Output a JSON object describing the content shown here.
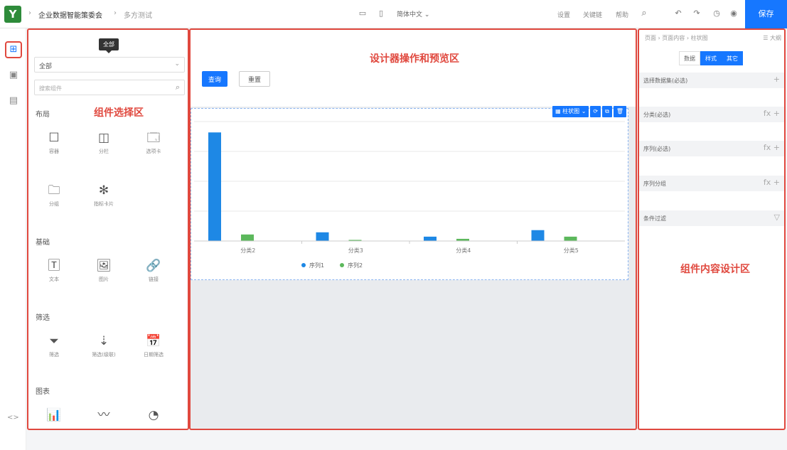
{
  "header": {
    "logo_text": "Y",
    "breadcrumb": [
      "企业数据智能策委会",
      "多方测试"
    ],
    "language": "简体中文",
    "links": [
      "设置",
      "关键链",
      "帮助"
    ],
    "save_label": "保存"
  },
  "rail": {
    "icons": [
      "components-icon",
      "layout-icon",
      "page-icon"
    ],
    "code_toggle": "<>"
  },
  "component_panel": {
    "area_title": "组件选择区",
    "tooltip": "全部",
    "select_value": "全部",
    "search_placeholder": "搜索组件",
    "sections": [
      {
        "label": "布局",
        "items": [
          {
            "label": "容器",
            "icon": "container-icon",
            "glyph": "☐"
          },
          {
            "label": "分栏",
            "icon": "columns-icon",
            "glyph": "◫"
          },
          {
            "label": "选项卡",
            "icon": "tabs-icon",
            "glyph": "🗔"
          },
          {
            "label": "分组",
            "icon": "folder-icon",
            "glyph": "🗀"
          },
          {
            "label": "指标卡片",
            "icon": "metric-card-icon",
            "glyph": "✻"
          }
        ]
      },
      {
        "label": "基础",
        "items": [
          {
            "label": "文本",
            "icon": "text-icon",
            "glyph": "🅃"
          },
          {
            "label": "图片",
            "icon": "image-icon",
            "glyph": "🖼"
          },
          {
            "label": "链接",
            "icon": "link-icon",
            "glyph": "🔗"
          }
        ]
      },
      {
        "label": "筛选",
        "items": [
          {
            "label": "筛选",
            "icon": "filter-icon",
            "glyph": "⏷"
          },
          {
            "label": "筛选(级联)",
            "icon": "cascade-filter-icon",
            "glyph": "⇣"
          },
          {
            "label": "日期筛选",
            "icon": "date-filter-icon",
            "glyph": "📅"
          }
        ]
      },
      {
        "label": "图表",
        "items": [
          {
            "label": "",
            "icon": "bar-chart-icon",
            "glyph": "📊"
          },
          {
            "label": "",
            "icon": "line-chart-icon",
            "glyph": "〰"
          },
          {
            "label": "",
            "icon": "pie-chart-icon",
            "glyph": "◔"
          }
        ]
      }
    ]
  },
  "designer": {
    "area_title": "设计器操作和预览区",
    "query_label": "查询",
    "reset_label": "重置",
    "chart_toolbar": [
      "柱状图",
      "⟳",
      "⧉",
      "🗑"
    ]
  },
  "property_panel": {
    "area_title": "组件内容设计区",
    "breadcrumb": "页面 › 页面内容 › 柱状图",
    "outline_label": "大纲",
    "tabs": [
      "数据",
      "样式",
      "其它"
    ],
    "active_tabs": [
      1,
      2
    ],
    "rows": [
      {
        "label": "选择数据集(必选)",
        "actions": "+"
      },
      {
        "label": "分类(必选)",
        "actions": "fx +"
      },
      {
        "label": "序列(必选)",
        "actions": "fx +"
      },
      {
        "label": "序列分组",
        "actions": "fx +"
      },
      {
        "label": "条件过滤",
        "actions": "▽"
      }
    ]
  },
  "colors": {
    "accent": "#1677ff",
    "annotation": "#e0483e",
    "series1": "#1e88e5",
    "series2": "#5cb85c"
  },
  "chart_data": {
    "type": "bar",
    "categories": [
      "分类2",
      "分类3",
      "分类4",
      "分类5"
    ],
    "series": [
      {
        "name": "序列1",
        "values": [
          100,
          8,
          4,
          10
        ]
      },
      {
        "name": "序列2",
        "values": [
          6,
          1,
          2,
          4
        ]
      }
    ],
    "ylim": [
      0,
      110
    ],
    "grid": true,
    "legend": "bottom-center"
  }
}
